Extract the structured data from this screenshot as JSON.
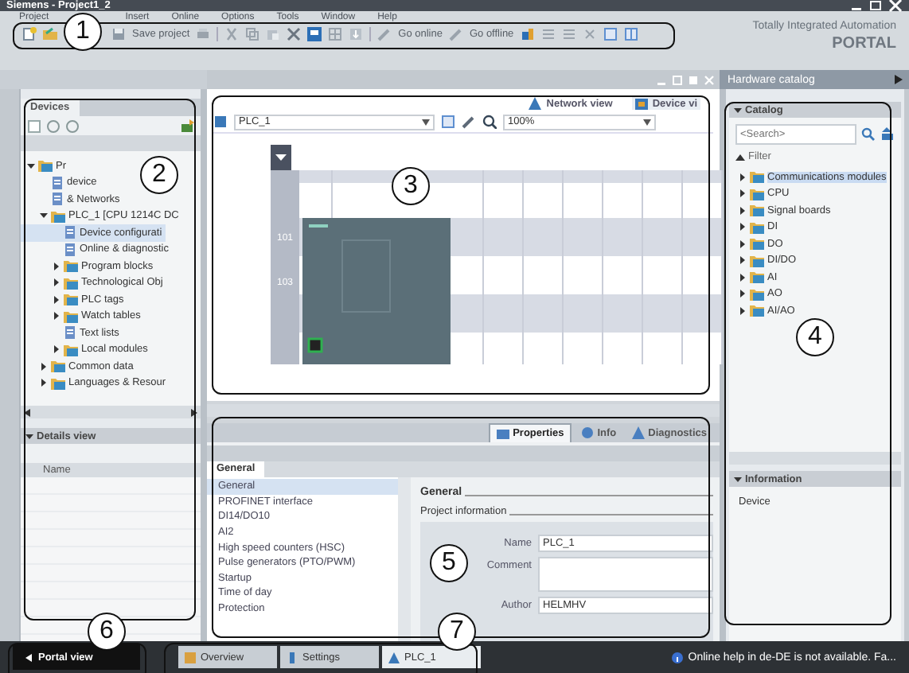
{
  "window": {
    "title": "Siemens - Project1_2"
  },
  "menu": [
    "Project",
    "Insert",
    "Online",
    "Options",
    "Tools",
    "Window",
    "Help"
  ],
  "toolbar": {
    "save_label": "Save project",
    "online_label": "Go online",
    "offline_label": "Go offline"
  },
  "brand": {
    "line1": "Totally Integrated Automation",
    "line2": "PORTAL"
  },
  "project_tree": {
    "tab": "Devices",
    "items": [
      {
        "label": "Pr",
        "expanded": true,
        "selected": false,
        "children": [
          {
            "label": "device",
            "selected": false
          },
          {
            "label": "& Networks",
            "selected": false
          },
          {
            "label": "PLC_1 [CPU 1214C DC",
            "expanded": true,
            "selected": false,
            "children": [
              {
                "label": "Device configurati",
                "selected": true
              },
              {
                "label": "Online & diagnostic",
                "selected": false
              },
              {
                "label": "Program blocks",
                "expanded": false,
                "selected": false
              },
              {
                "label": "Technological Obj",
                "expanded": false,
                "selected": false
              },
              {
                "label": "PLC tags",
                "expanded": false,
                "selected": false
              },
              {
                "label": "Watch tables",
                "expanded": false,
                "selected": false
              },
              {
                "label": "Text lists",
                "selected": false
              },
              {
                "label": "Local modules",
                "expanded": false,
                "selected": false
              }
            ]
          },
          {
            "label": "Common data",
            "expanded": false,
            "selected": false
          },
          {
            "label": "Languages & Resour",
            "expanded": false,
            "selected": false
          }
        ]
      }
    ],
    "details": {
      "title": "Details view",
      "column": "Name"
    }
  },
  "editor": {
    "views": [
      {
        "label": "Network view",
        "selected": false
      },
      {
        "label": "Device vi",
        "selected": true
      }
    ],
    "device": "PLC_1",
    "zoom": "100%",
    "slot_labels": [
      "101",
      "103"
    ]
  },
  "properties": {
    "tabs": [
      {
        "label": "Properties",
        "selected": true
      },
      {
        "label": "Info",
        "selected": false
      },
      {
        "label": "Diagnostics",
        "selected": false
      }
    ],
    "subtab": "General",
    "nav": [
      {
        "label": "General",
        "selected": true
      },
      {
        "label": "PROFINET interface",
        "selected": false
      },
      {
        "label": "DI14/DO10",
        "selected": false
      },
      {
        "label": "AI2",
        "selected": false
      },
      {
        "label": "High speed counters (HSC)",
        "selected": false
      },
      {
        "label": "Pulse generators (PTO/PWM)",
        "selected": false
      },
      {
        "label": "Startup",
        "selected": false
      },
      {
        "label": "Time of day",
        "selected": false
      },
      {
        "label": "Protection",
        "selected": false
      }
    ],
    "section": "General",
    "subsection": "Project information",
    "fields": [
      {
        "label": "Name",
        "kind": "line",
        "value": "PLC_1"
      },
      {
        "label": "Comment",
        "kind": "area"
      },
      {
        "label": "Author",
        "kind": "line",
        "value": "HELMHV"
      }
    ]
  },
  "catalog": {
    "header": "Hardware catalog",
    "title": "Catalog",
    "search_placeholder": "<Search>",
    "filter": "Filter",
    "filter_on": true,
    "items": [
      {
        "label": "Communications modules",
        "selected": true,
        "expanded": false
      },
      {
        "label": "CPU",
        "selected": false,
        "expanded": false
      },
      {
        "label": "Signal boards",
        "selected": false,
        "expanded": false
      },
      {
        "label": "DI",
        "selected": false,
        "expanded": false
      },
      {
        "label": "DO",
        "selected": false,
        "expanded": false
      },
      {
        "label": "DI/DO",
        "selected": false,
        "expanded": false
      },
      {
        "label": "AI",
        "selected": false,
        "expanded": false
      },
      {
        "label": "AO",
        "selected": false,
        "expanded": false
      },
      {
        "label": "AI/AO",
        "selected": false,
        "expanded": false
      }
    ],
    "info_title": "Information",
    "info_label": "Device"
  },
  "bottom": {
    "portal_button": "Portal view",
    "tabs": [
      {
        "label": "Overview",
        "selected": false
      },
      {
        "label": "Settings",
        "selected": false
      },
      {
        "label": "PLC_1",
        "selected": true
      }
    ],
    "status": "Online help in de-DE is not available. Fa..."
  },
  "callouts": [
    "1",
    "2",
    "3",
    "4",
    "5",
    "6",
    "7"
  ]
}
